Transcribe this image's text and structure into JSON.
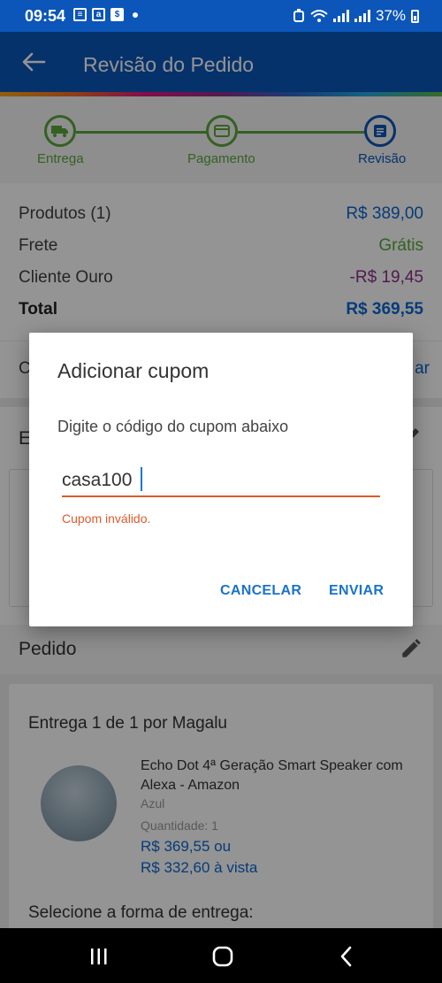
{
  "status_bar": {
    "time": "09:54",
    "battery": "37%"
  },
  "app_bar": {
    "title": "Revisão do Pedido"
  },
  "stepper": {
    "steps": [
      {
        "label": "Entrega",
        "icon": "truck-icon"
      },
      {
        "label": "Pagamento",
        "icon": "card-icon"
      },
      {
        "label": "Revisão",
        "icon": "document-icon"
      }
    ]
  },
  "summary": {
    "products_label": "Produtos (1)",
    "products_value": "R$ 389,00",
    "shipping_label": "Frete",
    "shipping_value": "Grátis",
    "gold_label": "Cliente Ouro",
    "gold_value": "-R$ 19,45",
    "total_label": "Total",
    "total_value": "R$ 369,55"
  },
  "coupon_row": {
    "label_partial": "C",
    "action_partial": "ar"
  },
  "address_section": {
    "title_partial": "E"
  },
  "order": {
    "title": "Pedido",
    "delivery_title": "Entrega 1 de 1 por Magalu",
    "product_name": "Echo Dot 4ª Geração Smart Speaker com Alexa - Amazon",
    "product_color": "Azul",
    "product_qty": "Quantidade:  1",
    "price_line": "R$ 369,55 ou",
    "cash_line": "R$ 332,60 à vista",
    "select_delivery": "Selecione a forma de entrega:"
  },
  "dialog": {
    "title": "Adicionar cupom",
    "message": "Digite o código do cupom abaixo",
    "input_value": "casa100",
    "error": "Cupom inválido.",
    "cancel_label": "CANCELAR",
    "send_label": "ENVIAR"
  },
  "colors": {
    "brand_blue": "#0b56b8",
    "success_green": "#57a836",
    "error_orange": "#e05a2b",
    "discount_purple": "#8e2d8a"
  }
}
